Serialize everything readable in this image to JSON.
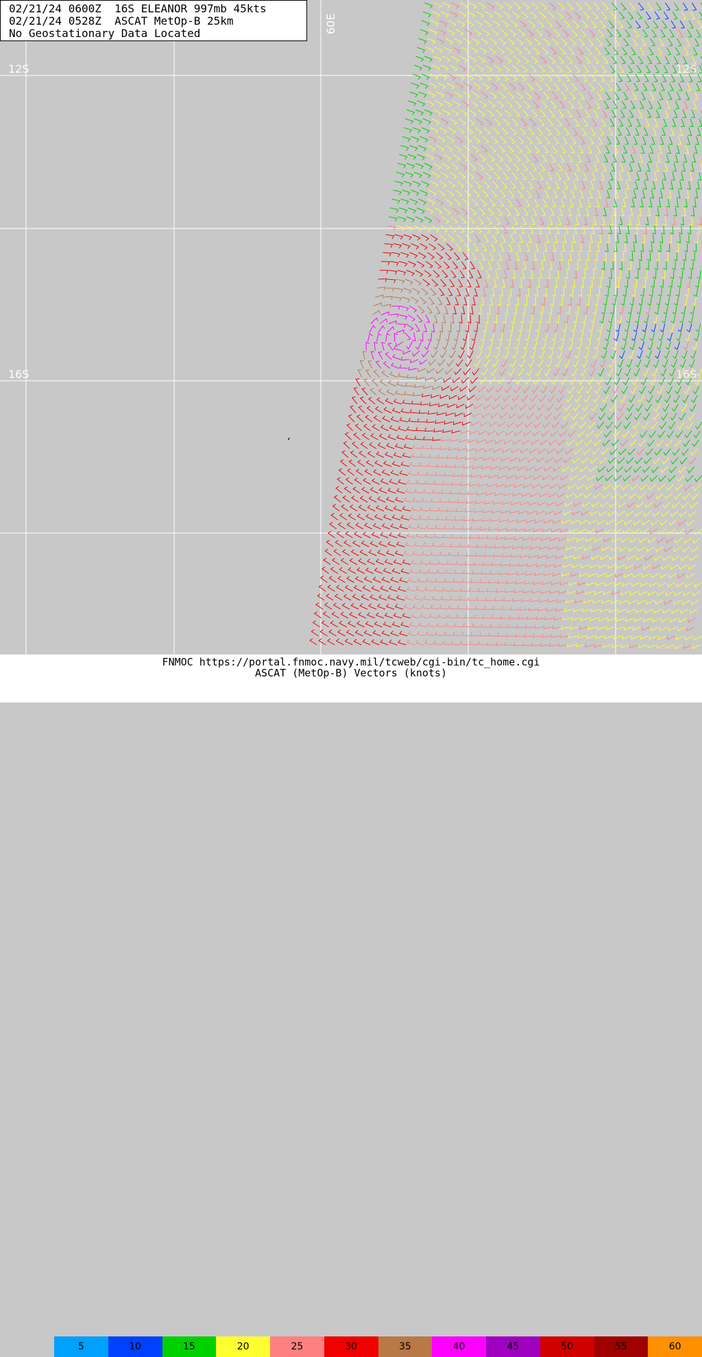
{
  "header": {
    "line1": "02/21/24 0600Z  16S ELEANOR 997mb 45kts",
    "line2": "02/21/24 0528Z  ASCAT MetOp-B 25km",
    "line3": "No Geostationary Data Located"
  },
  "map": {
    "lat_labels": [
      "12S",
      "16S"
    ],
    "lon_labels": [
      "60E"
    ],
    "right_labels": [
      "12S",
      "16S"
    ],
    "storm_marker": "storm-center-icon"
  },
  "footer": {
    "url_line": "FNMOC https://portal.fnmoc.navy.mil/tcweb/cgi-bin/tc_home.cgi",
    "product_line": "ASCAT (MetOp-B) Vectors (knots)"
  },
  "legend": [
    {
      "label": "5",
      "color": "#00a0ff"
    },
    {
      "label": "10",
      "color": "#0040ff"
    },
    {
      "label": "15",
      "color": "#00d000"
    },
    {
      "label": "20",
      "color": "#ffff30"
    },
    {
      "label": "25",
      "color": "#ff8080"
    },
    {
      "label": "30",
      "color": "#f00000"
    },
    {
      "label": "35",
      "color": "#b87848"
    },
    {
      "label": "40",
      "color": "#ff00ff"
    },
    {
      "label": "45",
      "color": "#a000c0"
    },
    {
      "label": "50",
      "color": "#d00000"
    },
    {
      "label": "55",
      "color": "#a00000"
    },
    {
      "label": "60",
      "color": "#ff9000"
    }
  ]
}
